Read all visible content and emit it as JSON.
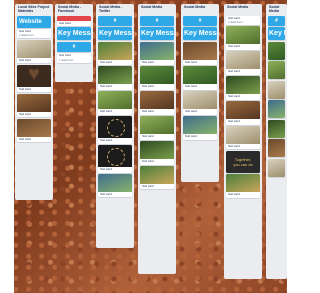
{
  "columns": [
    {
      "title": "Local Sites Project Materials",
      "website_label": "Website"
    },
    {
      "title": "Social Media - Facebook",
      "banner_hash": "#",
      "banner_big": "Key Messages"
    },
    {
      "title": "Social Media - Twitter",
      "banner_hash": "#",
      "banner_big": "Key Messages"
    },
    {
      "title": "Social Media",
      "banner_hash": "#",
      "banner_big": "Key Messages"
    },
    {
      "title": "Social Media",
      "banner_hash": "#",
      "banner_big": "Key Messages"
    },
    {
      "title": "Social Media"
    },
    {
      "title": "Social Media",
      "banner_hash": "#",
      "banner_big": "Key Messages"
    }
  ],
  "cards": {
    "generic_title": "Soil card",
    "generic_meta": "1 attachment",
    "slogan_line1": "Together,",
    "slogan_line2": "you can do"
  },
  "colors": {
    "accent": "#2ea8e6",
    "list_bg": "#ebecf0",
    "soil": "#9a4f2a",
    "alert": "#e2454a"
  }
}
